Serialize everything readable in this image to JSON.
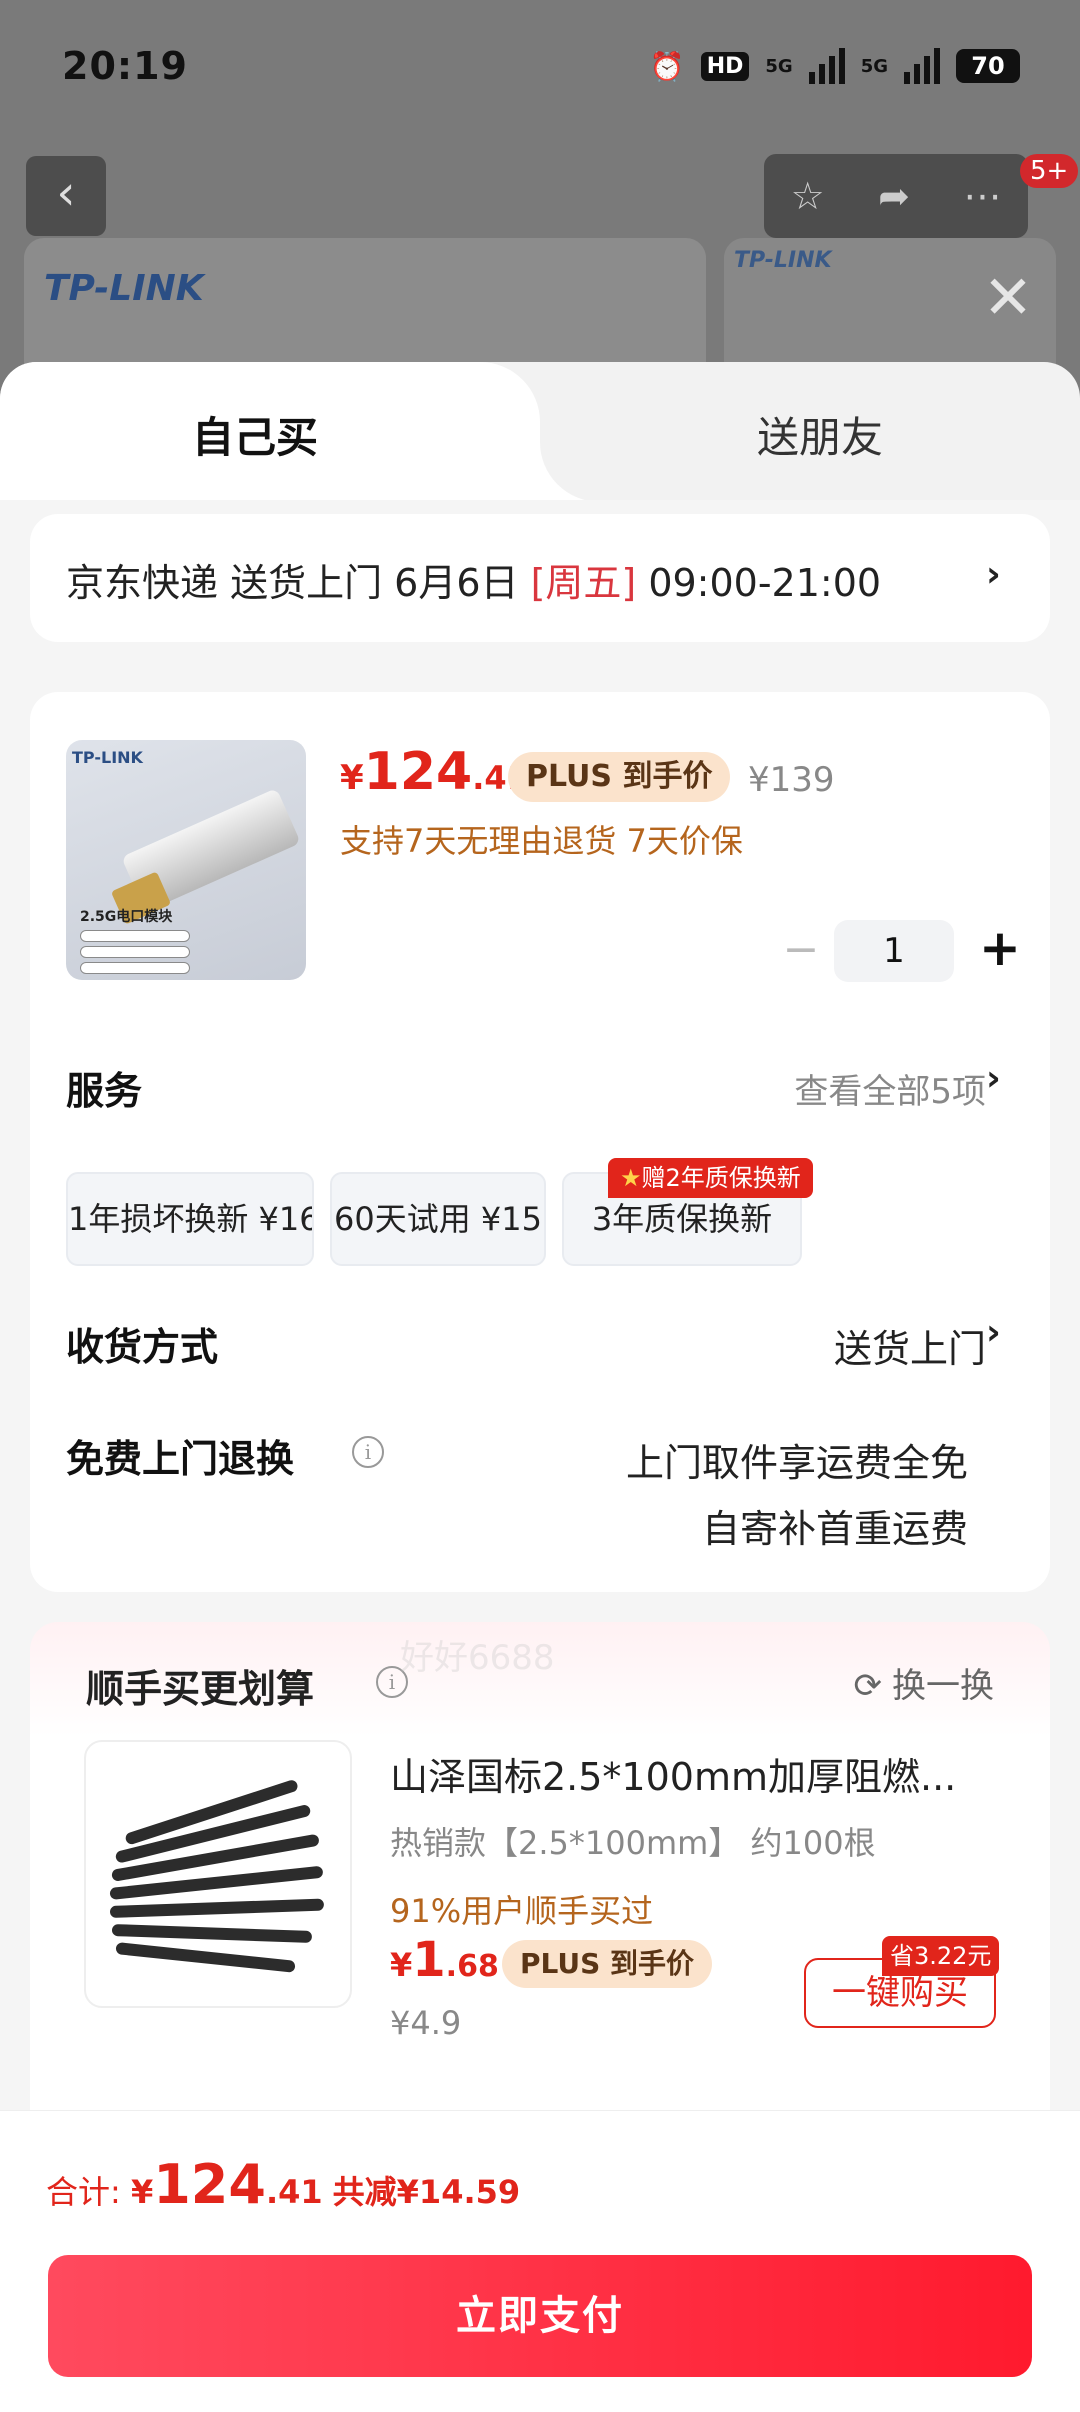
{
  "status_bar": {
    "time": "20:19",
    "net1": "5G",
    "net2": "5G",
    "hd": "HD",
    "battery": "70"
  },
  "background": {
    "brand_text": "TP-LINK",
    "badge": "5+",
    "back_icon": "chevron-left-icon",
    "actions": [
      "star-icon",
      "share-icon",
      "more-icon"
    ]
  },
  "tabs": {
    "self_buy": "自己买",
    "gift": "送朋友"
  },
  "delivery": {
    "prefix": "京东快递 送货上门 6月6日 ",
    "weekday": "[周五]",
    "time": " 09:00-21:00"
  },
  "product": {
    "image_brand": "TP-LINK",
    "image_caption": "2.5G电口模块",
    "price_symbol": "¥",
    "price_int": "124",
    "price_dec": ".41",
    "plus_label": "PLUS",
    "plus_text": "到手价",
    "original_price": "¥139",
    "guarantee": "支持7天无理由退货  7天价保",
    "quantity": "1",
    "minus": "−",
    "plus": "+"
  },
  "services": {
    "title": "服务",
    "view_all": "查看全部5项",
    "gift_badge": "赠2年质保换新",
    "items": [
      "1年损坏换新  ¥16",
      "60天试用  ¥15",
      "3年质保换新"
    ]
  },
  "receive": {
    "title": "收货方式",
    "value": "送货上门"
  },
  "free_return": {
    "title": "免费上门退换",
    "line1": "上门取件享运费全免",
    "line2": "自寄补首重运费"
  },
  "recommend": {
    "title": "顺手买更划算",
    "swap": "换一换",
    "name": "山泽国标2.5*100mm加厚阻燃...",
    "spec": "热销款【2.5*100mm】 约100根",
    "bought": "91%用户顺手买过",
    "price_symbol": "¥",
    "price_int": "1",
    "price_dec": ".68",
    "plus_label": "PLUS",
    "plus_text": "到手价",
    "original_price": "¥4.9",
    "save_tag": "省3.22元",
    "buy_button": "一键购买"
  },
  "footer": {
    "total_label": "合计: ",
    "price_symbol": "¥",
    "price_int": "124",
    "price_dec": ".41",
    "saved": "共减¥14.59",
    "pay_button": "立即支付"
  },
  "watermark": "好好6688"
}
